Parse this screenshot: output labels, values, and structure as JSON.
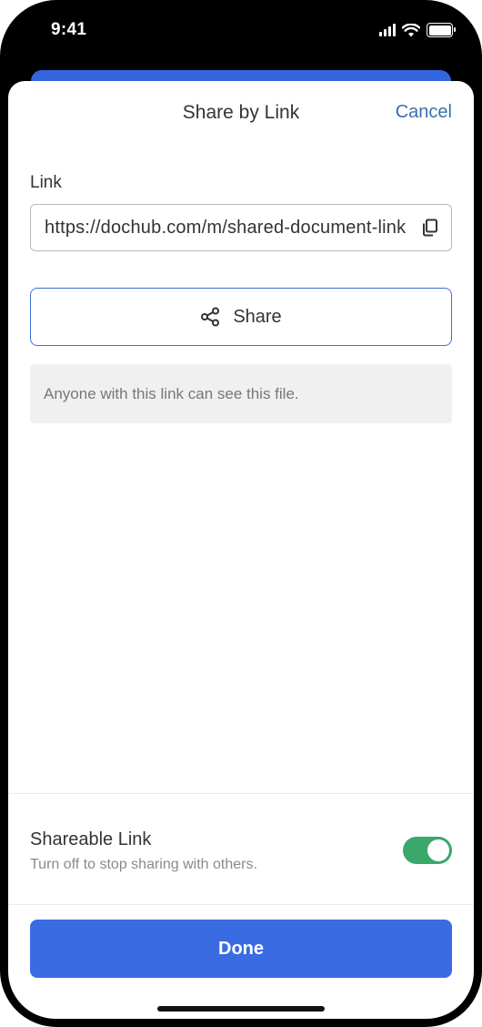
{
  "status_bar": {
    "time": "9:41"
  },
  "sheet": {
    "title": "Share by Link",
    "cancel_label": "Cancel"
  },
  "link": {
    "label": "Link",
    "value": "https://dochub.com/m/shared-document-link"
  },
  "share": {
    "label": "Share"
  },
  "info": {
    "text": "Anyone with this link can see this file."
  },
  "shareable_link": {
    "title": "Shareable Link",
    "subtitle": "Turn off to stop sharing with others.",
    "enabled": true
  },
  "done": {
    "label": "Done"
  },
  "colors": {
    "accent_blue": "#3b6be3",
    "cancel_blue": "#3b6fa8",
    "toggle_green": "#3aa86a",
    "info_bg": "#f0f0f0"
  },
  "icons": [
    "signal-icon",
    "wifi-icon",
    "battery-icon",
    "copy-icon",
    "share-icon"
  ]
}
